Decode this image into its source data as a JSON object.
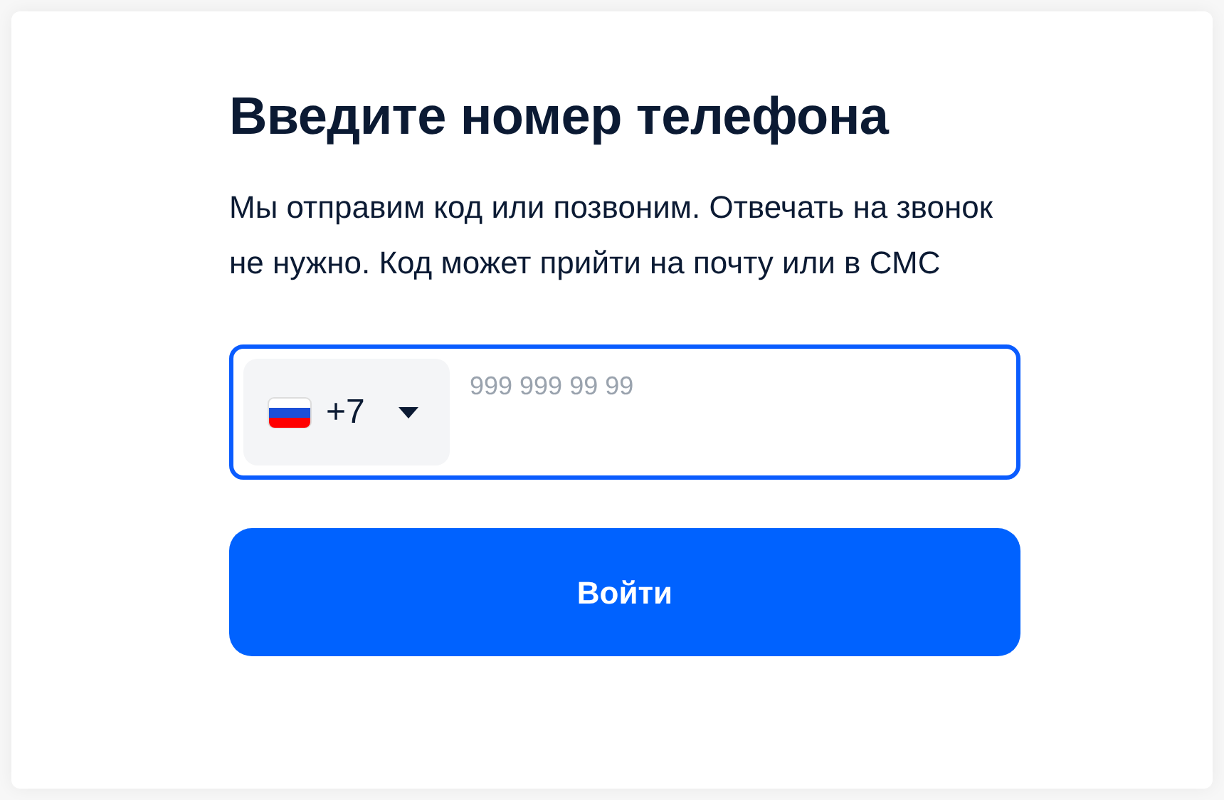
{
  "title": "Введите номер телефона",
  "description": "Мы отправим код или позвоним. Отвечать на звонок не нужно. Код может прийти на почту или в СМС",
  "phone_field": {
    "focused": true,
    "country_code": "+7",
    "placeholder": "999 999 99 99"
  },
  "submit_button": {
    "label": "Войти"
  }
}
